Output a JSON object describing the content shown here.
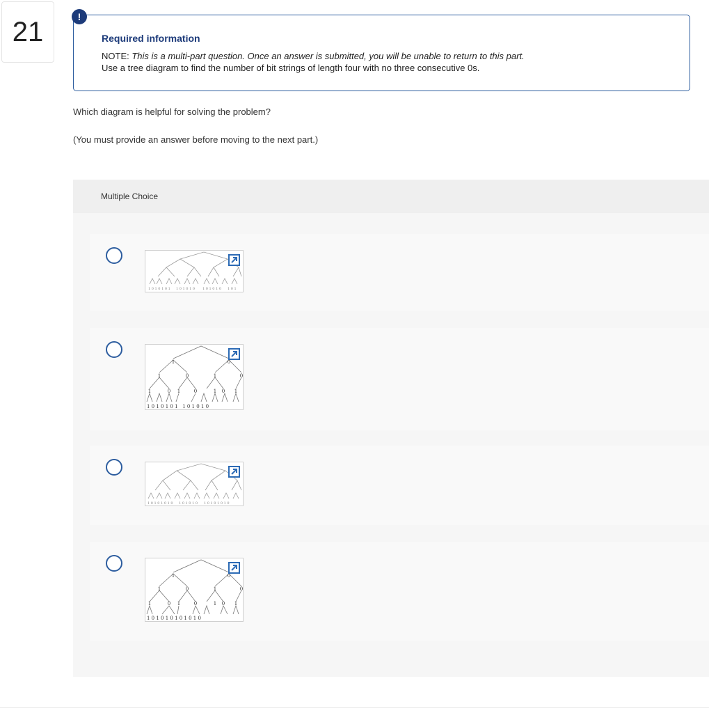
{
  "question": {
    "number": "21"
  },
  "info": {
    "icon": "!",
    "title": "Required information",
    "note_prefix": "NOTE: ",
    "note_italic": "This is a multi-part question. Once an answer is submitted, you will be unable to return to this part.",
    "line2": "Use a tree diagram to find the number of bit strings of length four with no three consecutive 0s."
  },
  "prompt": "Which diagram is helpful for solving the problem?",
  "prompt2": "(You must provide an answer before moving to the next part.)",
  "multiple_choice": {
    "label": "Multiple Choice",
    "options": [
      {
        "image": "tree-diagram-1",
        "expand_icon": "expand-icon"
      },
      {
        "image": "tree-diagram-2",
        "expand_icon": "expand-icon",
        "tree_labels": {
          "level1": [
            "1",
            "0"
          ],
          "level2": [
            "1",
            "0",
            "1",
            "0"
          ],
          "level3": [
            "1",
            "0",
            "1",
            "0",
            "1",
            "0",
            "1"
          ],
          "leaves": "1 0 1 0 1 0 1   1 0 1 0 1 0"
        }
      },
      {
        "image": "tree-diagram-3",
        "expand_icon": "expand-icon"
      },
      {
        "image": "tree-diagram-4",
        "expand_icon": "expand-icon",
        "tree_labels": {
          "level1": [
            "1",
            "0"
          ],
          "level2": [
            "1",
            "0",
            "1",
            "0"
          ],
          "level3": [
            "1",
            "0",
            "1",
            "0",
            "1",
            "0",
            "1"
          ],
          "leaves": "1 0 1 0 1 0 1 0 1 0 1 0"
        }
      }
    ]
  },
  "colors": {
    "accent": "#2d5d9f",
    "title": "#1d3b7a",
    "panel": "#f6f6f6"
  }
}
